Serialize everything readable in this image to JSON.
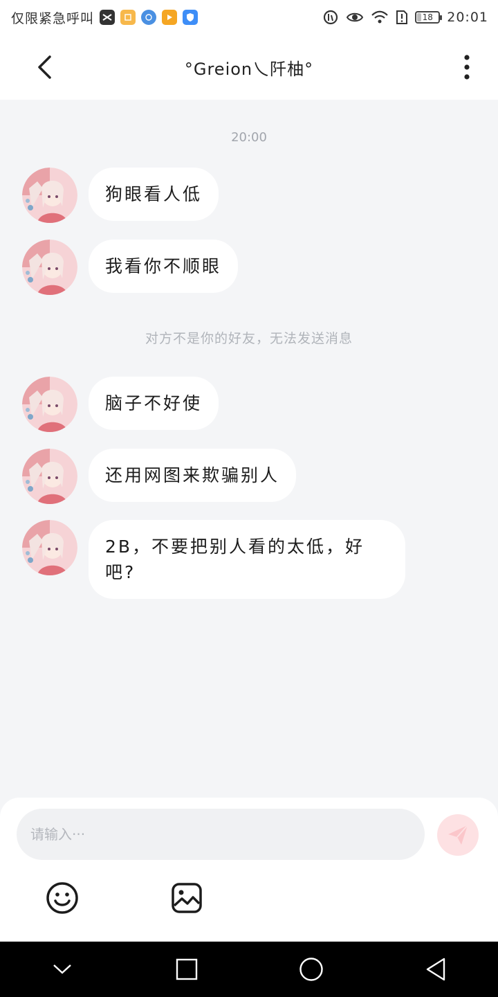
{
  "status_bar": {
    "carrier_text": "仅限紧急呼叫",
    "time": "20:01",
    "app_icons": [
      {
        "name": "capcut-icon",
        "color": "#333333"
      },
      {
        "name": "note-app-icon",
        "color": "#f7b84b"
      },
      {
        "name": "browser-app-icon",
        "color": "#4a90e2"
      },
      {
        "name": "video-app-icon",
        "color": "#f5a623"
      },
      {
        "name": "shield-app-icon",
        "color": "#3e8ef7"
      }
    ],
    "battery_label": "18"
  },
  "header": {
    "title": "°Greion乀阡柚°"
  },
  "chat": {
    "time_label": "20:00",
    "system_notice": "对方不是你的好友，无法发送消息",
    "messages": [
      {
        "text": "狗眼看人低"
      },
      {
        "text": "我看你不顺眼"
      },
      {
        "text": "脑子不好使"
      },
      {
        "text": "还用网图来欺骗别人"
      },
      {
        "text": "2B，不要把别人看的太低，好吧?"
      }
    ]
  },
  "input": {
    "placeholder": "请输入···"
  },
  "colors": {
    "background": "#f4f5f7",
    "bubble": "#ffffff",
    "send_button": "#fde1e3",
    "accent": "#f08a90"
  }
}
